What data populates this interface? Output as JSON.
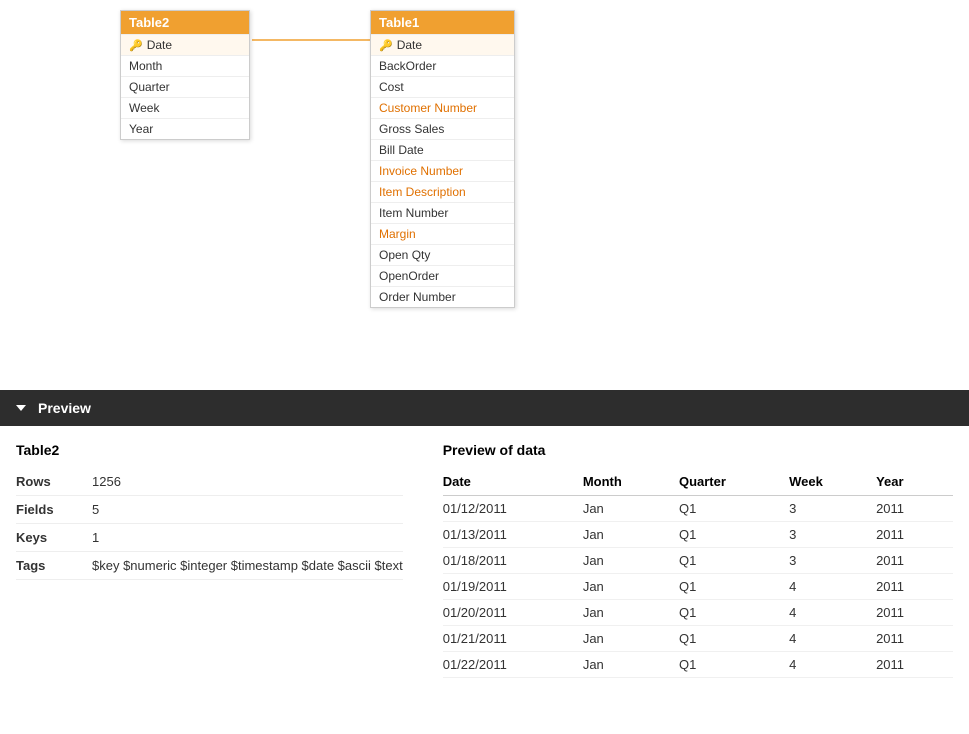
{
  "diagram": {
    "table2": {
      "name": "Table2",
      "fields": [
        {
          "label": "Date",
          "key": true
        },
        {
          "label": "Month",
          "key": false
        },
        {
          "label": "Quarter",
          "key": false
        },
        {
          "label": "Week",
          "key": false
        },
        {
          "label": "Year",
          "key": false
        }
      ]
    },
    "table1": {
      "name": "Table1",
      "fields": [
        {
          "label": "Date",
          "key": true
        },
        {
          "label": "BackOrder",
          "key": false
        },
        {
          "label": "Cost",
          "key": false
        },
        {
          "label": "Customer Number",
          "key": false
        },
        {
          "label": "Gross Sales",
          "key": false
        },
        {
          "label": "Bill Date",
          "key": false
        },
        {
          "label": "Invoice Number",
          "key": false
        },
        {
          "label": "Item Description",
          "key": false
        },
        {
          "label": "Item Number",
          "key": false
        },
        {
          "label": "Margin",
          "key": false
        },
        {
          "label": "Open Qty",
          "key": false
        },
        {
          "label": "OpenOrder",
          "key": false
        },
        {
          "label": "Order Number",
          "key": false
        }
      ]
    }
  },
  "preview": {
    "title": "Preview",
    "table_name": "Table2",
    "rows_label": "Rows",
    "rows_value": "1256",
    "fields_label": "Fields",
    "fields_value": "5",
    "keys_label": "Keys",
    "keys_value": "1",
    "tags_label": "Tags",
    "tags_value": "$key $numeric $integer $timestamp $date $ascii $text",
    "data_title": "Preview of data",
    "columns": [
      "Date",
      "Month",
      "Quarter",
      "Week",
      "Year"
    ],
    "rows": [
      [
        "01/12/2011",
        "Jan",
        "Q1",
        "3",
        "2011"
      ],
      [
        "01/13/2011",
        "Jan",
        "Q1",
        "3",
        "2011"
      ],
      [
        "01/18/2011",
        "Jan",
        "Q1",
        "3",
        "2011"
      ],
      [
        "01/19/2011",
        "Jan",
        "Q1",
        "4",
        "2011"
      ],
      [
        "01/20/2011",
        "Jan",
        "Q1",
        "4",
        "2011"
      ],
      [
        "01/21/2011",
        "Jan",
        "Q1",
        "4",
        "2011"
      ],
      [
        "01/22/2011",
        "Jan",
        "Q1",
        "4",
        "2011"
      ]
    ]
  }
}
